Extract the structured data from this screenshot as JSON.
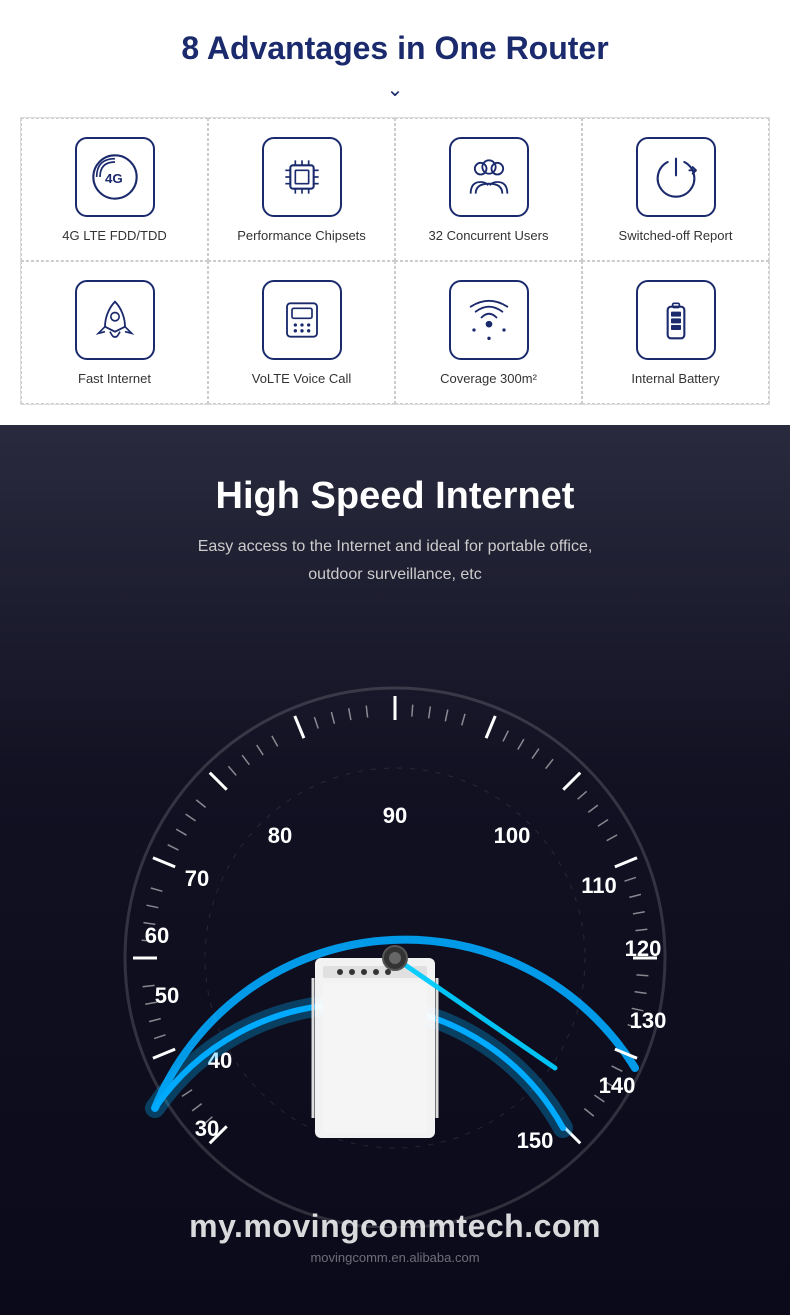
{
  "advantages": {
    "title": "8 Advantages in One Router",
    "items": [
      {
        "id": "4g-lte",
        "label": "4G LTE FDD/TDD",
        "icon": "4g"
      },
      {
        "id": "chipset",
        "label": "Performance Chipsets",
        "icon": "chip"
      },
      {
        "id": "users",
        "label": "32 Concurrent Users",
        "icon": "users"
      },
      {
        "id": "switched-off",
        "label": "Switched-off Report",
        "icon": "power"
      },
      {
        "id": "fast-internet",
        "label": "Fast Internet",
        "icon": "rocket"
      },
      {
        "id": "volte",
        "label": "VoLTE Voice Call",
        "icon": "phone"
      },
      {
        "id": "coverage",
        "label": "Coverage 300m²",
        "icon": "wifi"
      },
      {
        "id": "battery",
        "label": "Internal Battery",
        "icon": "battery"
      }
    ]
  },
  "speed": {
    "title": "High Speed Internet",
    "subtitle_line1": "Easy access to the Internet and ideal for portable office,",
    "subtitle_line2": "outdoor surveillance, etc",
    "speedometer_numbers": [
      "30",
      "40",
      "50",
      "60",
      "70",
      "80",
      "90",
      "100",
      "110",
      "120",
      "130",
      "140",
      "150"
    ],
    "needle_value": 150
  },
  "footer": {
    "website": "my.movingcommtech.com",
    "sub": "movingcomm.en.alibaba.com"
  }
}
